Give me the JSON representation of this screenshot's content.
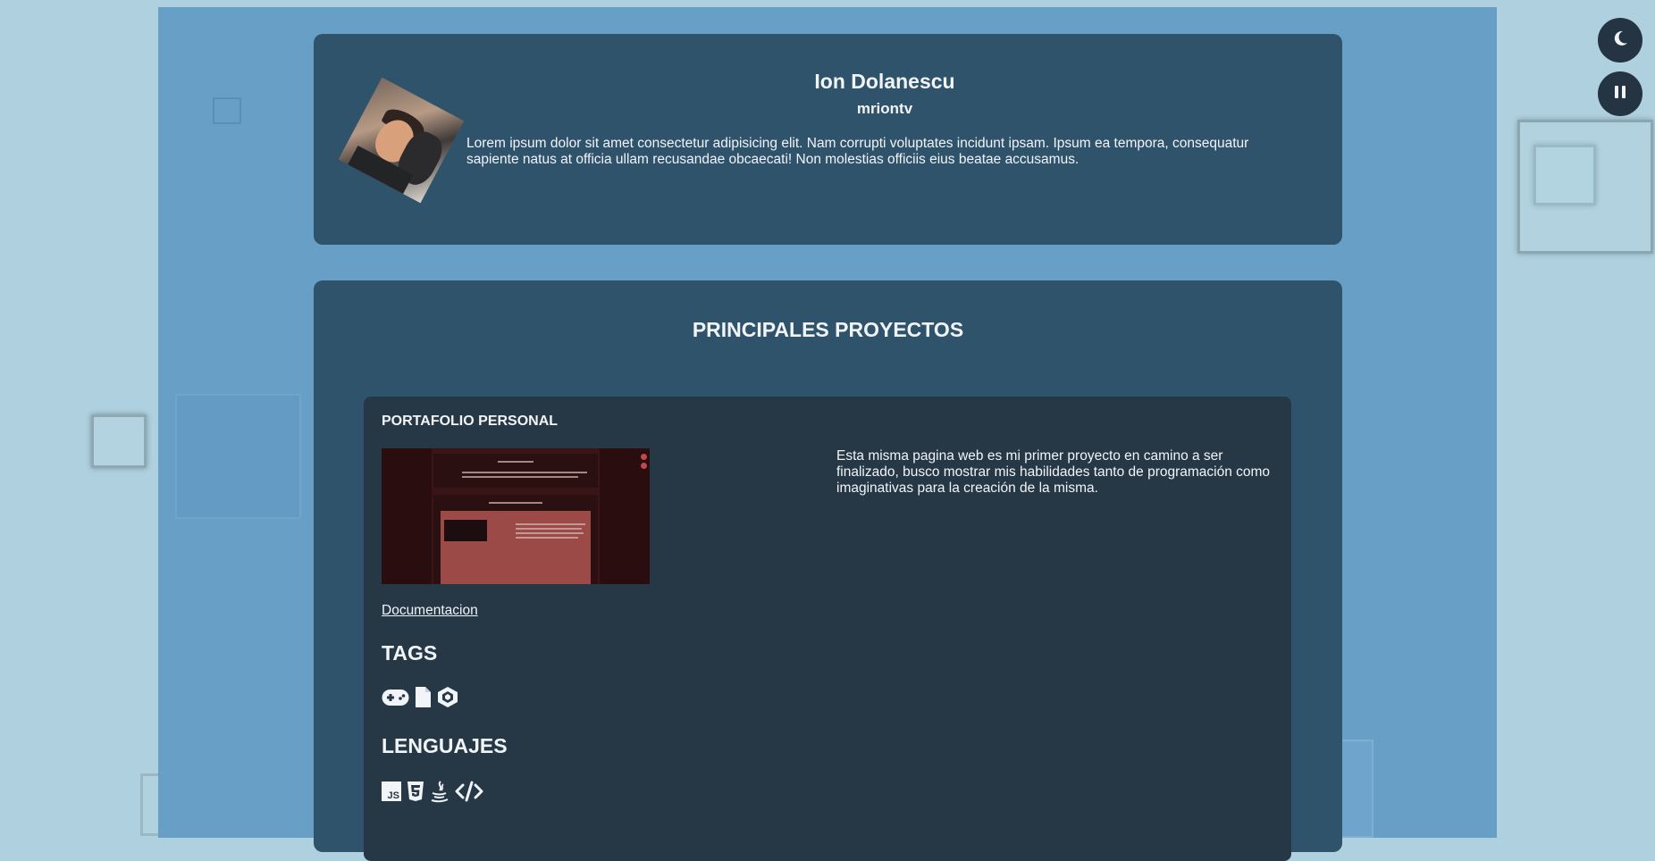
{
  "profile": {
    "name": "Ion Dolanescu",
    "username": "mriontv",
    "bio": "Lorem ipsum dolor sit amet consectetur adipisicing elit. Nam corrupti voluptates incidunt ipsam. Ipsum ea tempora, consequatur sapiente natus at officia ullam recusandae obcaecati! Non molestias officiis eius beatae accusamus.",
    "avatar_icon": "profile-photo"
  },
  "projects": {
    "section_title": "PRINCIPALES PROYECTOS",
    "items": [
      {
        "title": "PORTAFOLIO PERSONAL",
        "description": "Esta misma pagina web es mi primer proyecto en camino a ser finalizado, busco mostrar mis habilidades tanto de programación como imaginativas para la creación de la misma.",
        "doc_link": "Documentacion",
        "tags_heading": "TAGS",
        "tags_icons": [
          "gamepad-icon",
          "file-icon",
          "unity-icon"
        ],
        "languages_heading": "LENGUAJES",
        "languages_icons": [
          "js-icon",
          "html5-icon",
          "java-icon",
          "code-icon"
        ]
      }
    ]
  },
  "controls": {
    "theme_toggle_icon": "moon-icon",
    "pause_icon": "pause-icon"
  },
  "colors": {
    "background": "#afd0de",
    "page_column": "#679fc7",
    "card": "#30536c",
    "project_card": "#263846",
    "text": "#f1f4f8",
    "button": "#243443"
  }
}
